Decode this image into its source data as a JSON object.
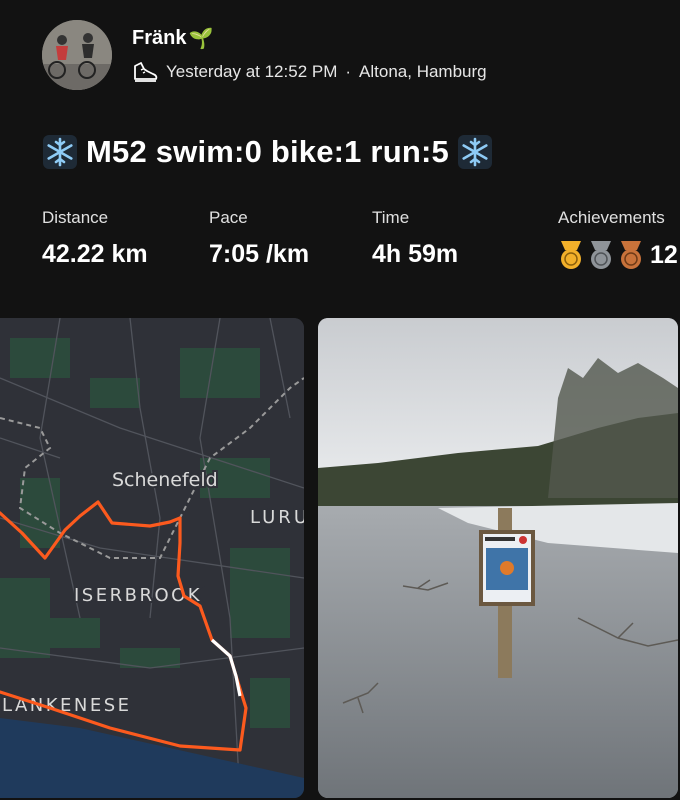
{
  "user": {
    "name": "Fränk",
    "name_emoji": "🌱",
    "activity_icon": "running-shoe-icon",
    "timestamp": "Yesterday at 12:52 PM",
    "separator": "·",
    "location": "Altona, Hamburg"
  },
  "activity": {
    "title": "M52 swim:0 bike:1 run:5",
    "title_icon": "snowflake-icon"
  },
  "stats": {
    "distance": {
      "label": "Distance",
      "value": "42.22 km"
    },
    "pace": {
      "label": "Pace",
      "value": "7:05 /km"
    },
    "time": {
      "label": "Time",
      "value": "4h 59m"
    },
    "achievements": {
      "label": "Achievements",
      "count": "12",
      "medals": [
        "gold-medal-icon",
        "silver-medal-icon",
        "bronze-medal-icon"
      ]
    }
  },
  "map": {
    "labels": {
      "schenefeld": "Schenefeld",
      "lurup": "LURU",
      "iserbrook": "ISERBROOK",
      "blankenese": "LANKENESE"
    }
  },
  "colors": {
    "background": "#121212",
    "route": "#fc5a1e",
    "map_base": "#2f3138",
    "gold": "#f2b02a",
    "silver": "#8f9499",
    "bronze": "#c8723a"
  }
}
